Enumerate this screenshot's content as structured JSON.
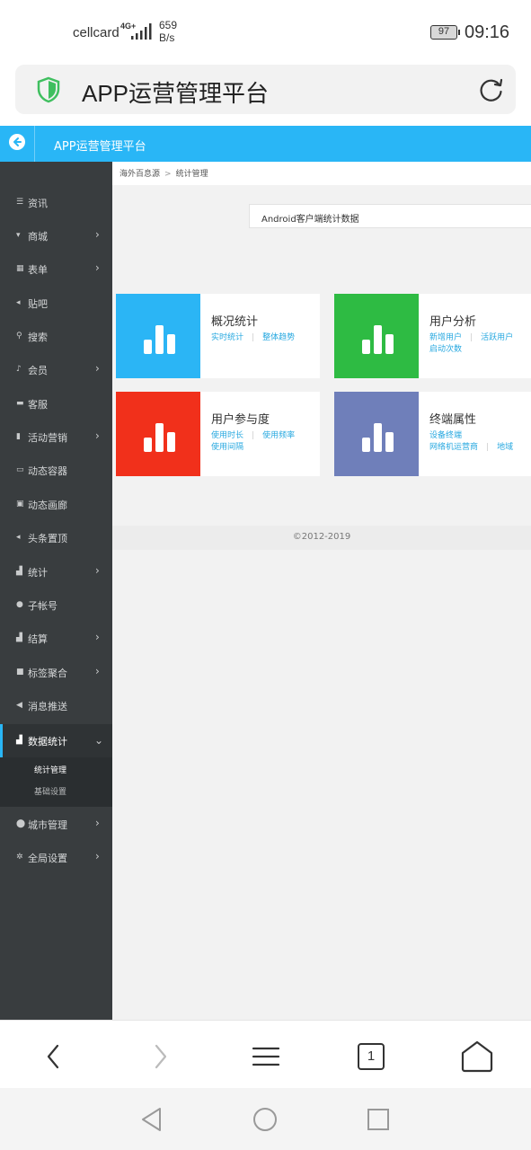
{
  "status_bar": {
    "carrier": "cellcard",
    "network": "4G+",
    "speed_value": "659",
    "speed_unit": "B/s",
    "battery": "97",
    "time": "09:16"
  },
  "browser": {
    "url_title": "APP运营管理平台",
    "icons": {
      "security": "shield-icon",
      "reload": "reload-icon"
    }
  },
  "app_header": {
    "title": "APP运营管理平台"
  },
  "sidebar": {
    "items": [
      {
        "label": "资讯",
        "icon": "list-icon",
        "has_children": false
      },
      {
        "label": "商城",
        "icon": "cart-icon",
        "has_children": true
      },
      {
        "label": "表单",
        "icon": "form-icon",
        "has_children": true
      },
      {
        "label": "贴吧",
        "icon": "megaphone-icon",
        "has_children": false
      },
      {
        "label": "搜索",
        "icon": "search-icon",
        "has_children": false
      },
      {
        "label": "会员",
        "icon": "bell-icon",
        "has_children": true
      },
      {
        "label": "客服",
        "icon": "comment-icon",
        "has_children": false
      },
      {
        "label": "活动营销",
        "icon": "bookmark-icon",
        "has_children": true
      },
      {
        "label": "动态容器",
        "icon": "container-icon",
        "has_children": false
      },
      {
        "label": "动态画廊",
        "icon": "picture-icon",
        "has_children": false
      },
      {
        "label": "头条置顶",
        "icon": "speaker-icon",
        "has_children": false
      },
      {
        "label": "统计",
        "icon": "bar-chart-icon",
        "has_children": true
      },
      {
        "label": "子帐号",
        "icon": "user-icon",
        "has_children": false
      },
      {
        "label": "结算",
        "icon": "bar-chart-icon",
        "has_children": true
      },
      {
        "label": "标签聚合",
        "icon": "tag-icon",
        "has_children": true
      },
      {
        "label": "消息推送",
        "icon": "send-icon",
        "has_children": false
      },
      {
        "label": "数据统计",
        "icon": "bar-chart-icon",
        "has_children": true,
        "active": true
      },
      {
        "label": "城市管理",
        "icon": "location-icon",
        "has_children": true
      },
      {
        "label": "全局设置",
        "icon": "gear-icon",
        "has_children": true
      }
    ],
    "sub_items": [
      "统计管理",
      "基础设置"
    ]
  },
  "breadcrumb": {
    "home": "海外百息源",
    "separator": ">",
    "current": "统计管理"
  },
  "select": {
    "value": "Android客户端统计数据"
  },
  "cards": [
    {
      "title": "概况统计",
      "color": "#2bb5f5",
      "links": [
        "实时统计",
        "整体趋势"
      ]
    },
    {
      "title": "用户分析",
      "color": "#2ebb43",
      "links": [
        "新增用户",
        "活跃用户",
        "启动次数"
      ]
    },
    {
      "title": "用户参与度",
      "color": "#f1301b",
      "links": [
        "使用时长",
        "使用频率",
        "使用间隔"
      ]
    },
    {
      "title": "终端属性",
      "color": "#6f7fba",
      "links": [
        "设备终端",
        "网络机运营商",
        "地域"
      ]
    }
  ],
  "footer": {
    "copyright": "©2012-2019"
  },
  "browser_toolbar": {
    "icons": [
      "back-arrow-icon",
      "forward-arrow-icon",
      "menu-icon",
      "tabs-icon",
      "home-icon"
    ],
    "tab_count": "1"
  },
  "system_nav": {
    "icons": [
      "triangle-back-icon",
      "circle-home-icon",
      "square-recents-icon"
    ]
  },
  "colors": {
    "accent": "#29b6f6",
    "sidebar_bg": "#393d3f",
    "link": "#29a9e0"
  }
}
